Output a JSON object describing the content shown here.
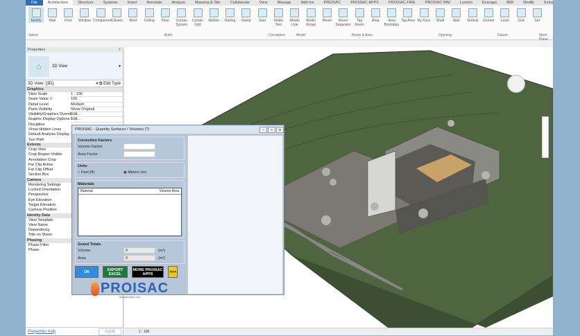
{
  "ribbon": {
    "tabs": [
      "File",
      "Architecture",
      "Structure",
      "Systems",
      "Insert",
      "Annotate",
      "Analyze",
      "Massing & Site",
      "Collaborate",
      "View",
      "Manage",
      "Add-Ins",
      "PROISAC",
      "PROISAC APPS",
      "PROISAC FIRE",
      "PROISAC BIM",
      "Lumion",
      "Enscape",
      "BIM",
      "Modify",
      "Extra"
    ],
    "tools": [
      "Modify",
      "Wall",
      "Door",
      "Window",
      "Component",
      "Column",
      "Roof",
      "Ceiling",
      "Floor",
      "Curtain System",
      "Curtain Grid",
      "Mullion",
      "Railing",
      "Ramp",
      "Stair",
      "Model Text",
      "Model Line",
      "Model Group",
      "Room",
      "Room Separator",
      "Tag Room",
      "Area",
      "Area Boundary",
      "Tag Area",
      "By Face",
      "Shaft",
      "Wall",
      "Vertical",
      "Dormer",
      "Level",
      "Grid",
      "Set"
    ],
    "groups": [
      "Select",
      "Build",
      "Circulation",
      "Model",
      "Room & Area",
      "Opening",
      "Datum",
      "Work Plane"
    ]
  },
  "properties": {
    "title": "Properties",
    "type": "3D View",
    "selector": "3D View: {3D}",
    "edit_type": "Edit Type",
    "sections": [
      {
        "name": "Graphics",
        "rows": [
          [
            "View Scale",
            "1 : 100"
          ],
          [
            "Scale Value 1:",
            "100"
          ],
          [
            "Detail Level",
            "Medium"
          ],
          [
            "Parts Visibility",
            "Show Original"
          ],
          [
            "Visibility/Graphics Overrides",
            "Edit..."
          ],
          [
            "Graphic Display Options",
            "Edit..."
          ],
          [
            "Discipline",
            ""
          ],
          [
            "Show Hidden Lines",
            ""
          ],
          [
            "Default Analysis Display Style",
            ""
          ],
          [
            "Sun Path",
            ""
          ]
        ]
      },
      {
        "name": "Extents",
        "rows": [
          [
            "Crop View",
            ""
          ],
          [
            "Crop Region Visible",
            ""
          ],
          [
            "Annotation Crop",
            ""
          ],
          [
            "Far Clip Active",
            ""
          ],
          [
            "Far Clip Offset",
            ""
          ],
          [
            "Section Box",
            ""
          ]
        ]
      },
      {
        "name": "Camera",
        "rows": [
          [
            "Rendering Settings",
            ""
          ],
          [
            "Locked Orientation",
            ""
          ],
          [
            "Perspective",
            ""
          ],
          [
            "Eye Elevation",
            ""
          ],
          [
            "Target Elevation",
            ""
          ],
          [
            "Camera Position",
            ""
          ]
        ]
      },
      {
        "name": "Identity Data",
        "rows": [
          [
            "View Template",
            ""
          ],
          [
            "View Name",
            ""
          ],
          [
            "Dependency",
            ""
          ],
          [
            "Title on Sheet",
            ""
          ]
        ]
      },
      {
        "name": "Phasing",
        "rows": [
          [
            "Phase Filter",
            ""
          ],
          [
            "Phase",
            ""
          ]
        ]
      }
    ],
    "help": "Properties help",
    "apply": "Apply"
  },
  "status": {
    "scale": "1 : 100"
  },
  "dialog": {
    "title": "PROISAC - Quantity Surfaces / Volumes (?)",
    "correction": {
      "legend": "Correction Factors",
      "volume_label": "Volume Factor",
      "area_label": "Area Factor",
      "volume_value": "",
      "area_value": ""
    },
    "units": {
      "legend": "Units",
      "feet": "Feet (ft)",
      "meters": "Meters (m)"
    },
    "materials": {
      "legend": "Materials",
      "headers": [
        "Material",
        "Volume",
        "Area"
      ]
    },
    "totals": {
      "legend": "Grand Totals",
      "volume_label": "Volume",
      "volume_value": "0",
      "volume_unit": "(m³)",
      "area_label": "Area",
      "area_value": "0",
      "area_unit": "(m²)"
    },
    "buttons": {
      "ok": "OK",
      "export": "EXPORT EXCEL",
      "more": "MORE PROISAC APPS",
      "next": ">>>"
    },
    "logo": "PROISAC",
    "logo_sub": "www.proisac.com"
  }
}
